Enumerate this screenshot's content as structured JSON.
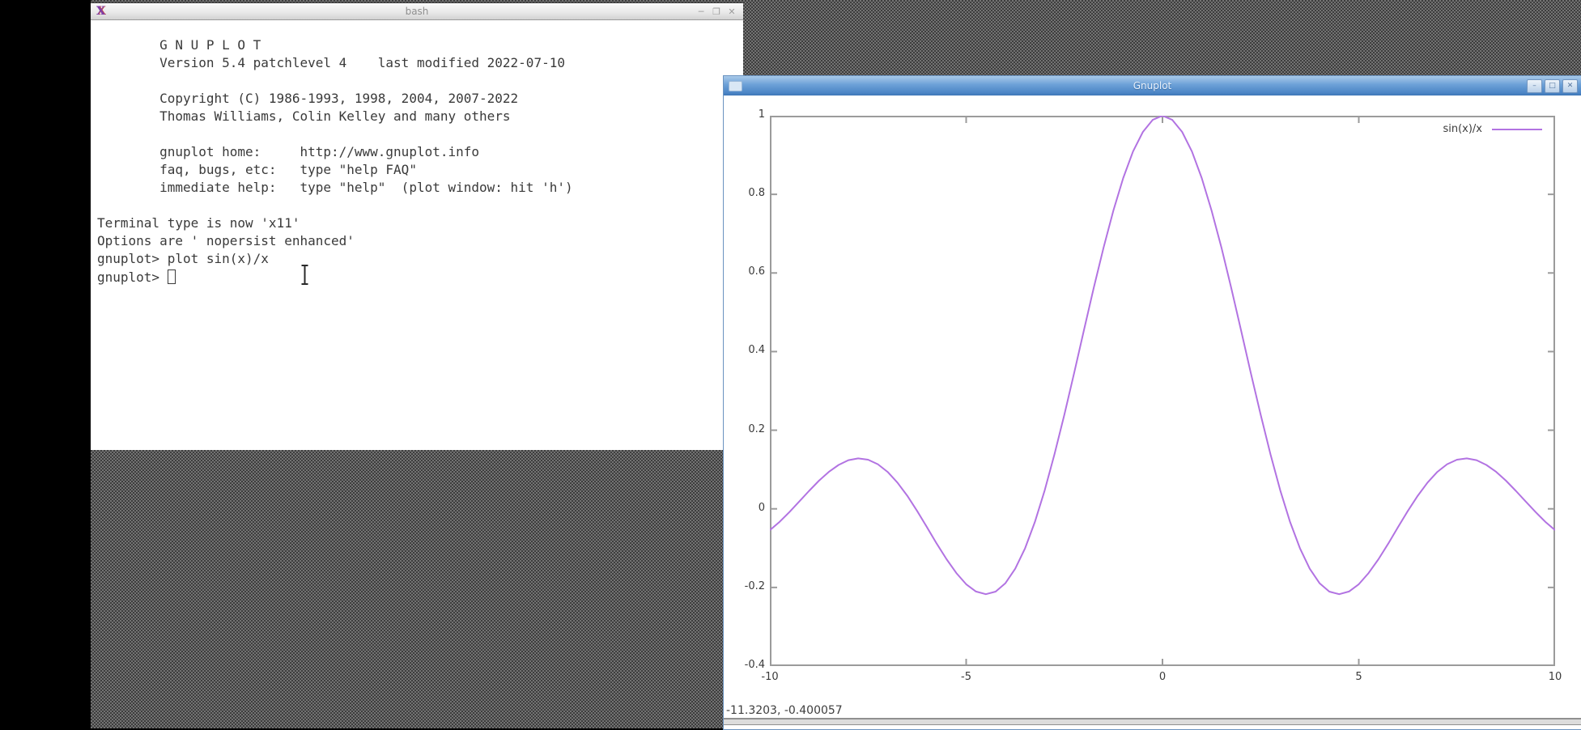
{
  "terminal_window": {
    "title": "bash",
    "buttons": {
      "minimize": "─",
      "maximize": "❐",
      "close": "✕"
    },
    "lines": [
      "        G N U P L O T",
      "        Version 5.4 patchlevel 4    last modified 2022-07-10",
      "",
      "        Copyright (C) 1986-1993, 1998, 2004, 2007-2022",
      "        Thomas Williams, Colin Kelley and many others",
      "",
      "        gnuplot home:     http://www.gnuplot.info",
      "        faq, bugs, etc:   type \"help FAQ\"",
      "        immediate help:   type \"help\"  (plot window: hit 'h')",
      "",
      "Terminal type is now 'x11'",
      "Options are ' nopersist enhanced'",
      "gnuplot> plot sin(x)/x"
    ],
    "prompt": "gnuplot> "
  },
  "gnuplot_window": {
    "title": "Gnuplot",
    "buttons": {
      "minimize": "–",
      "maximize": "□",
      "close": "✕"
    },
    "status_readout": "-11.3203, -0.400057",
    "titlebar_color": "#5f96cf"
  },
  "chart_data": {
    "type": "line",
    "title": "",
    "xlabel": "",
    "ylabel": "",
    "xlim": [
      -10,
      10
    ],
    "ylim": [
      -0.4,
      1
    ],
    "xticks": [
      -10,
      -5,
      0,
      5,
      10
    ],
    "xtick_labels": [
      "-10",
      "-5",
      "0",
      "5",
      "10"
    ],
    "yticks": [
      1,
      0.8,
      0.6,
      0.4,
      0.2,
      0,
      -0.2,
      -0.4
    ],
    "ytick_labels": [
      "1",
      "0.8",
      "0.6",
      "0.4",
      "0.2",
      "0",
      "-0.2",
      "-0.4"
    ],
    "grid": false,
    "legend_position": "top-right",
    "border_color": "#9b9b9b",
    "series": [
      {
        "name": "sin(x)/x",
        "formula": "sin(x)/x",
        "color": "#b273e2",
        "x_start": -10,
        "x_step": 0.25,
        "y": [
          -0.0544,
          -0.0329,
          -0.0079,
          0.0188,
          0.0458,
          0.0714,
          0.0939,
          0.1117,
          0.1237,
          0.1283,
          0.1251,
          0.1135,
          0.0939,
          0.0667,
          0.0331,
          -0.0053,
          -0.0466,
          -0.0884,
          -0.1283,
          -0.1635,
          -0.1918,
          -0.2104,
          -0.2172,
          -0.2105,
          -0.1892,
          -0.1524,
          -0.1002,
          -0.0333,
          0.047,
          0.1388,
          0.2394,
          0.3458,
          0.4546,
          0.5623,
          0.665,
          0.7592,
          0.8415,
          0.9089,
          0.9589,
          0.9896,
          1.0,
          0.9896,
          0.9589,
          0.9089,
          0.8415,
          0.7592,
          0.665,
          0.5623,
          0.4546,
          0.3458,
          0.2394,
          0.1388,
          0.047,
          -0.0333,
          -0.1002,
          -0.1524,
          -0.1892,
          -0.2105,
          -0.2172,
          -0.2104,
          -0.1918,
          -0.1635,
          -0.1283,
          -0.0884,
          -0.0466,
          -0.0053,
          0.0331,
          0.0667,
          0.0939,
          0.1135,
          0.1251,
          0.1283,
          0.1237,
          0.1117,
          0.0939,
          0.0714,
          0.0458,
          0.0188,
          -0.0079,
          -0.0329,
          -0.0544
        ]
      }
    ]
  }
}
